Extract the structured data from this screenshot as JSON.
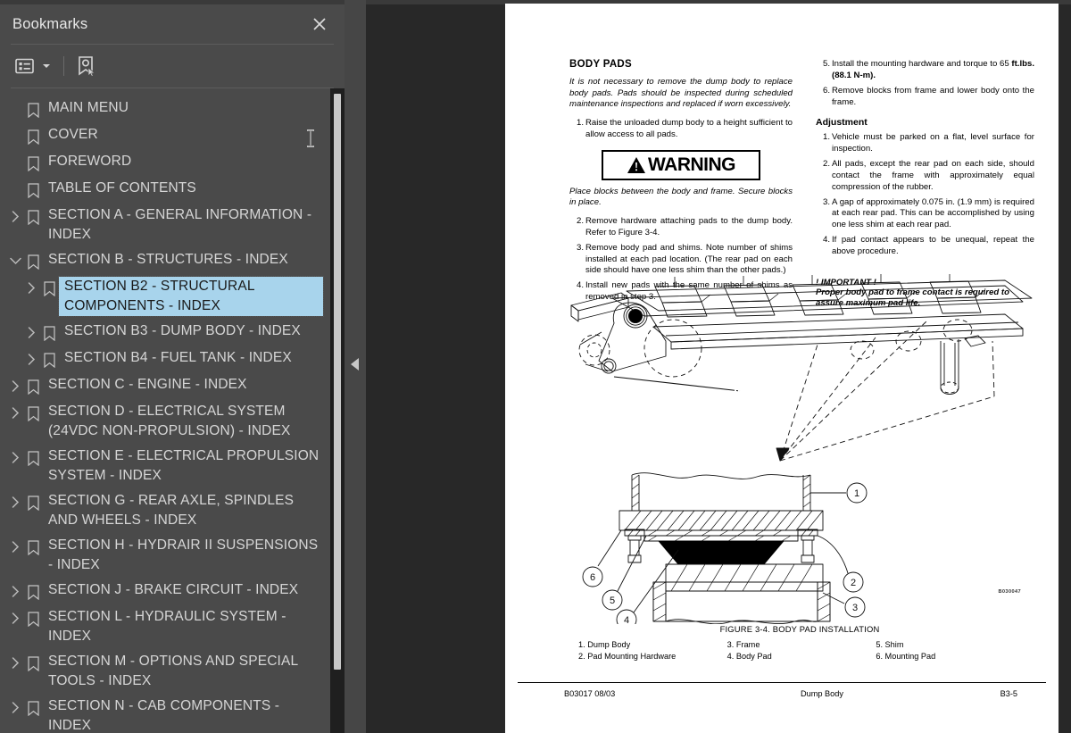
{
  "panel": {
    "title": "Bookmarks",
    "close_icon": "close-icon",
    "toolbar": {
      "options_label": "options-list-icon",
      "options_caret": "chevron-down-icon",
      "bookmark_tool_label": "bookmark-select-icon"
    }
  },
  "bookmarks": [
    {
      "label": "MAIN MENU",
      "depth": 0,
      "twisty": "none",
      "selected": false
    },
    {
      "label": "COVER",
      "depth": 0,
      "twisty": "none",
      "selected": false
    },
    {
      "label": "FOREWORD",
      "depth": 0,
      "twisty": "none",
      "selected": false
    },
    {
      "label": "TABLE OF CONTENTS",
      "depth": 0,
      "twisty": "none",
      "selected": false
    },
    {
      "label": "SECTION A - GENERAL INFORMATION - INDEX",
      "depth": 0,
      "twisty": "collapsed",
      "selected": false
    },
    {
      "label": "SECTION B - STRUCTURES - INDEX",
      "depth": 0,
      "twisty": "expanded",
      "selected": false
    },
    {
      "label": "SECTION B2 - STRUCTURAL COMPONENTS - INDEX",
      "depth": 1,
      "twisty": "collapsed",
      "selected": true
    },
    {
      "label": "SECTION B3 - DUMP BODY - INDEX",
      "depth": 1,
      "twisty": "collapsed",
      "selected": false
    },
    {
      "label": "SECTION B4 - FUEL TANK - INDEX",
      "depth": 1,
      "twisty": "collapsed",
      "selected": false
    },
    {
      "label": "SECTION C - ENGINE - INDEX",
      "depth": 0,
      "twisty": "collapsed",
      "selected": false
    },
    {
      "label": "SECTION D - ELECTRICAL SYSTEM (24VDC NON-PROPULSION) - INDEX",
      "depth": 0,
      "twisty": "collapsed",
      "selected": false
    },
    {
      "label": "SECTION E - ELECTRICAL PROPULSION SYSTEM - INDEX",
      "depth": 0,
      "twisty": "collapsed",
      "selected": false
    },
    {
      "label": "SECTION G - REAR AXLE, SPINDLES AND WHEELS - INDEX",
      "depth": 0,
      "twisty": "collapsed",
      "selected": false
    },
    {
      "label": "SECTION H - HYDRAIR II SUSPENSIONS - INDEX",
      "depth": 0,
      "twisty": "collapsed",
      "selected": false
    },
    {
      "label": "SECTION J - BRAKE CIRCUIT - INDEX",
      "depth": 0,
      "twisty": "collapsed",
      "selected": false
    },
    {
      "label": "SECTION L - HYDRAULIC SYSTEM - INDEX",
      "depth": 0,
      "twisty": "collapsed",
      "selected": false
    },
    {
      "label": "SECTION M - OPTIONS AND SPECIAL TOOLS - INDEX",
      "depth": 0,
      "twisty": "collapsed",
      "selected": false
    },
    {
      "label": "SECTION N - CAB COMPONENTS - INDEX",
      "depth": 0,
      "twisty": "collapsed",
      "selected": false
    }
  ],
  "splitter": {
    "collapse_icon": "triangle-left-icon"
  },
  "document": {
    "heading": "BODY PADS",
    "intro": "It is not necessary to remove the dump body to replace body pads. Pads should be inspected during scheduled maintenance inspections and replaced if worn excessively.",
    "steps_before_warning": [
      {
        "num": "1.",
        "text": "Raise the unloaded dump body to a height sufficient to allow access to all pads."
      }
    ],
    "warning": {
      "label": "WARNING",
      "icon": "warning-triangle-icon",
      "text": "Place blocks between the body and frame. Secure blocks in place."
    },
    "steps_after_warning": [
      {
        "num": "2.",
        "text": "Remove hardware attaching pads to the dump body. Refer to Figure 3-4."
      },
      {
        "num": "3.",
        "text": "Remove body pad and shims. Note number of shims installed at each pad location. (The rear pad on each side should have one less shim than the other pads.)"
      },
      {
        "num": "4.",
        "text": "Install new pads with the same number of shims as removed in step 3."
      }
    ],
    "steps_right": [
      {
        "num": "5.",
        "text": "Install the mounting hardware and torque to 65 ",
        "bold": "ft.lbs. (88.1 N-m)."
      },
      {
        "num": "6.",
        "text": "Remove blocks from frame and lower body onto the frame."
      }
    ],
    "adjustment_heading": "Adjustment",
    "adjustment_steps": [
      {
        "num": "1.",
        "text": "Vehicle must be parked on a flat, level surface for inspection."
      },
      {
        "num": "2.",
        "text": "All pads, except the rear pad on each side, should contact the frame with approximately equal compression of the rubber."
      },
      {
        "num": "3.",
        "text": "A gap of approximately 0.075 in. (1.9 mm) is required at each rear pad. This can be accomplished by using one less shim at each rear pad."
      },
      {
        "num": "4.",
        "text": "If pad contact appears to be unequal, repeat the above procedure."
      }
    ],
    "important_head": "! IMPORTANT !",
    "important_body": "Proper body pad to frame contact is required to assure maximum pad life.",
    "figure": {
      "caption": "FIGURE 3-4. BODY PAD INSTALLATION",
      "drawing_code": "B030047",
      "legend_col1": [
        "1. Dump Body",
        "2. Pad Mounting Hardware"
      ],
      "legend_col2": [
        "3. Frame",
        "4. Body Pad"
      ],
      "legend_col3": [
        "5. Shim",
        "6. Mounting Pad"
      ],
      "callouts": [
        "1",
        "2",
        "3",
        "4",
        "5",
        "6"
      ]
    },
    "footer": {
      "left": "B03017  08/03",
      "center": "Dump Body",
      "right": "B3-5"
    }
  },
  "colors": {
    "panel_bg": "#4a4a4a",
    "viewer_bg": "#282828",
    "selection": "#a8d4ec",
    "text": "#d6d6d6",
    "scrollbar_track": "#1f1f1f",
    "scrollbar_thumb": "#c9c9c9"
  }
}
